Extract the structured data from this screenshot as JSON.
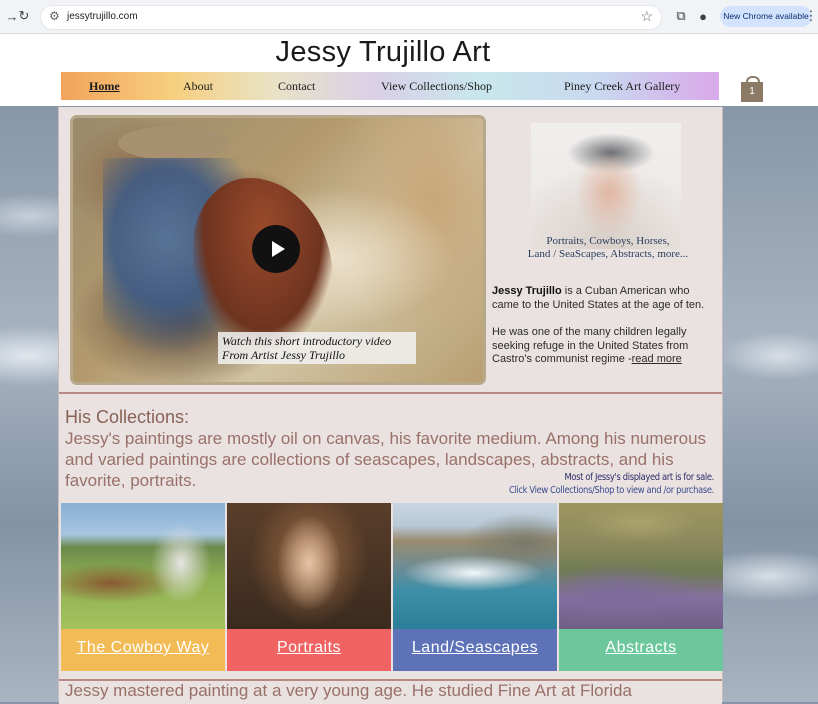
{
  "browser": {
    "url": "jessytrujillo.com",
    "update_label": "New Chrome available"
  },
  "site": {
    "title": "Jessy Trujillo Art",
    "cart_count": "1"
  },
  "nav": {
    "items": [
      {
        "label": "Home"
      },
      {
        "label": "About"
      },
      {
        "label": "Contact"
      },
      {
        "label": "View Collections/Shop"
      },
      {
        "label": "Piney Creek Art Gallery"
      }
    ]
  },
  "video": {
    "caption_line1": "Watch this short introductory video",
    "caption_line2": "From Artist Jessy Trujillo"
  },
  "artist": {
    "photo_caption_line1": "Portraits, Cowboys, Horses,",
    "photo_caption_line2": "Land / SeaScapes, Abstracts, more...",
    "name": "Jessy Trujillo",
    "bio1_rest": " is a Cuban American who came to the United States at the age of ten.",
    "bio2": "He was one of the many children legally seeking refuge in the United States from Castro's communist regime -",
    "read_more": "read more"
  },
  "collections": {
    "heading": "His Collections:",
    "body": "Jessy's paintings are mostly oil on canvas, his favorite medium. Among his numerous and varied paintings are collections of seascapes, landscapes, abstracts, and his favorite, portraits.",
    "sale_note_line1": "Most of Jessy's displayed art is for sale.",
    "sale_note_line2": "Click View Collections/Shop to view and /or purchase.",
    "tiles": [
      {
        "label": "The Cowboy Way",
        "color": "#f3bb55"
      },
      {
        "label": "Portraits",
        "color": "#f16262"
      },
      {
        "label": "Land/Seascapes",
        "color": "#5e72b8"
      },
      {
        "label": "Abstracts",
        "color": "#6cc79d"
      }
    ]
  },
  "bottom": {
    "text": "Jessy mastered painting at a very young age. He studied Fine Art at Florida"
  }
}
